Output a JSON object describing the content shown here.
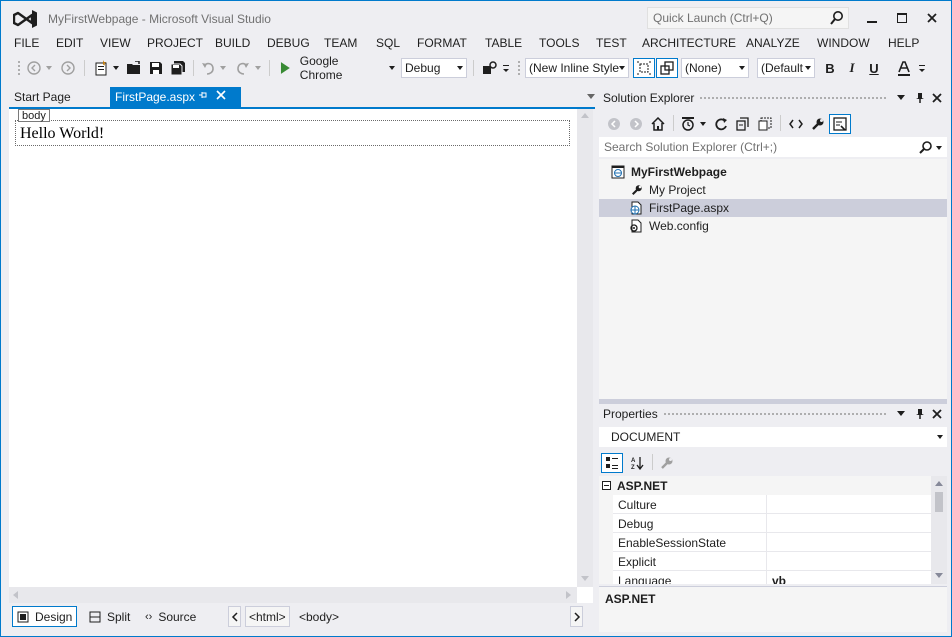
{
  "window": {
    "title": "MyFirstWebpage - Microsoft Visual Studio",
    "quick_launch_placeholder": "Quick Launch (Ctrl+Q)"
  },
  "menu": [
    "FILE",
    "EDIT",
    "VIEW",
    "PROJECT",
    "BUILD",
    "DEBUG",
    "TEAM",
    "SQL",
    "FORMAT",
    "TABLE",
    "TOOLS",
    "TEST",
    "ARCHITECTURE",
    "ANALYZE",
    "WINDOW",
    "HELP"
  ],
  "toolbar": {
    "run_target": "Google Chrome",
    "configuration": "Debug",
    "style_dropdown": "(New Inline Style",
    "target_rule": "(None)",
    "font_dropdown": "(Default",
    "bold": "B",
    "italic": "I",
    "underline": "U"
  },
  "documents": {
    "tabs": [
      "Start Page",
      "FirstPage.aspx"
    ],
    "active": "FirstPage.aspx"
  },
  "editor": {
    "selected_tag": "body",
    "content": "Hello World!"
  },
  "editor_bottom": {
    "views": [
      "Design",
      "Split",
      "Source"
    ],
    "tag_path": [
      "<html>",
      "<body>"
    ]
  },
  "solution_explorer": {
    "title": "Solution Explorer",
    "search_placeholder": "Search Solution Explorer (Ctrl+;)",
    "root": "MyFirstWebpage",
    "items": [
      "My Project",
      "FirstPage.aspx",
      "Web.config"
    ],
    "selected": "FirstPage.aspx"
  },
  "properties": {
    "title": "Properties",
    "object": "DOCUMENT",
    "category": "ASP.NET",
    "rows": [
      {
        "name": "Culture",
        "value": ""
      },
      {
        "name": "Debug",
        "value": ""
      },
      {
        "name": "EnableSessionState",
        "value": ""
      },
      {
        "name": "Explicit",
        "value": ""
      },
      {
        "name": "Language",
        "value": "vb"
      }
    ],
    "description_title": "ASP.NET"
  },
  "colors": {
    "accent": "#007acc",
    "chrome": "#eeeef2",
    "selected_row": "#cccedb",
    "run_green": "#388a34"
  }
}
